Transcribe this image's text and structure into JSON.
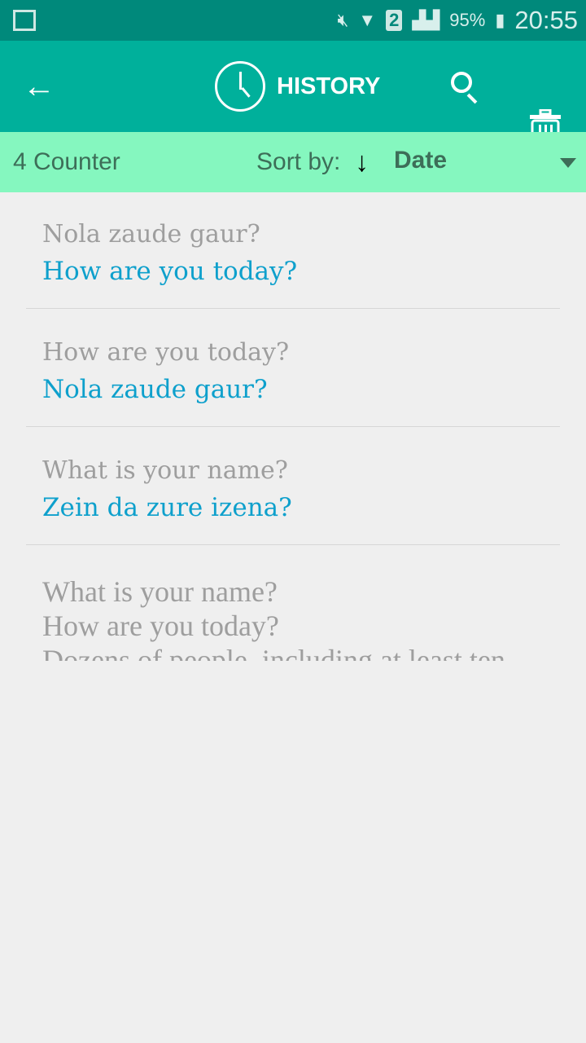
{
  "status_bar": {
    "battery": "95%",
    "time": "20:55",
    "sim": "2"
  },
  "app_bar": {
    "title": "HISTORY"
  },
  "sort_bar": {
    "counter": "4 Counter",
    "sort_label": "Sort by:",
    "sort_value": "Date"
  },
  "history": [
    {
      "source": "Nola zaude gaur?",
      "translation": "How are you today?"
    },
    {
      "source": "How are you today?",
      "translation": "Nola zaude gaur?"
    },
    {
      "source": "What is your name?",
      "translation": "Zein da zure izena?"
    },
    {
      "lines": [
        "What is your name?",
        "How are you today?",
        "Dozens of people, including at least ten"
      ]
    }
  ],
  "colors": {
    "status": "#00897b",
    "appbar": "#00b09b",
    "sortbar": "#85f7bf",
    "translation": "#0ea0cc",
    "source": "#9e9e9e"
  }
}
